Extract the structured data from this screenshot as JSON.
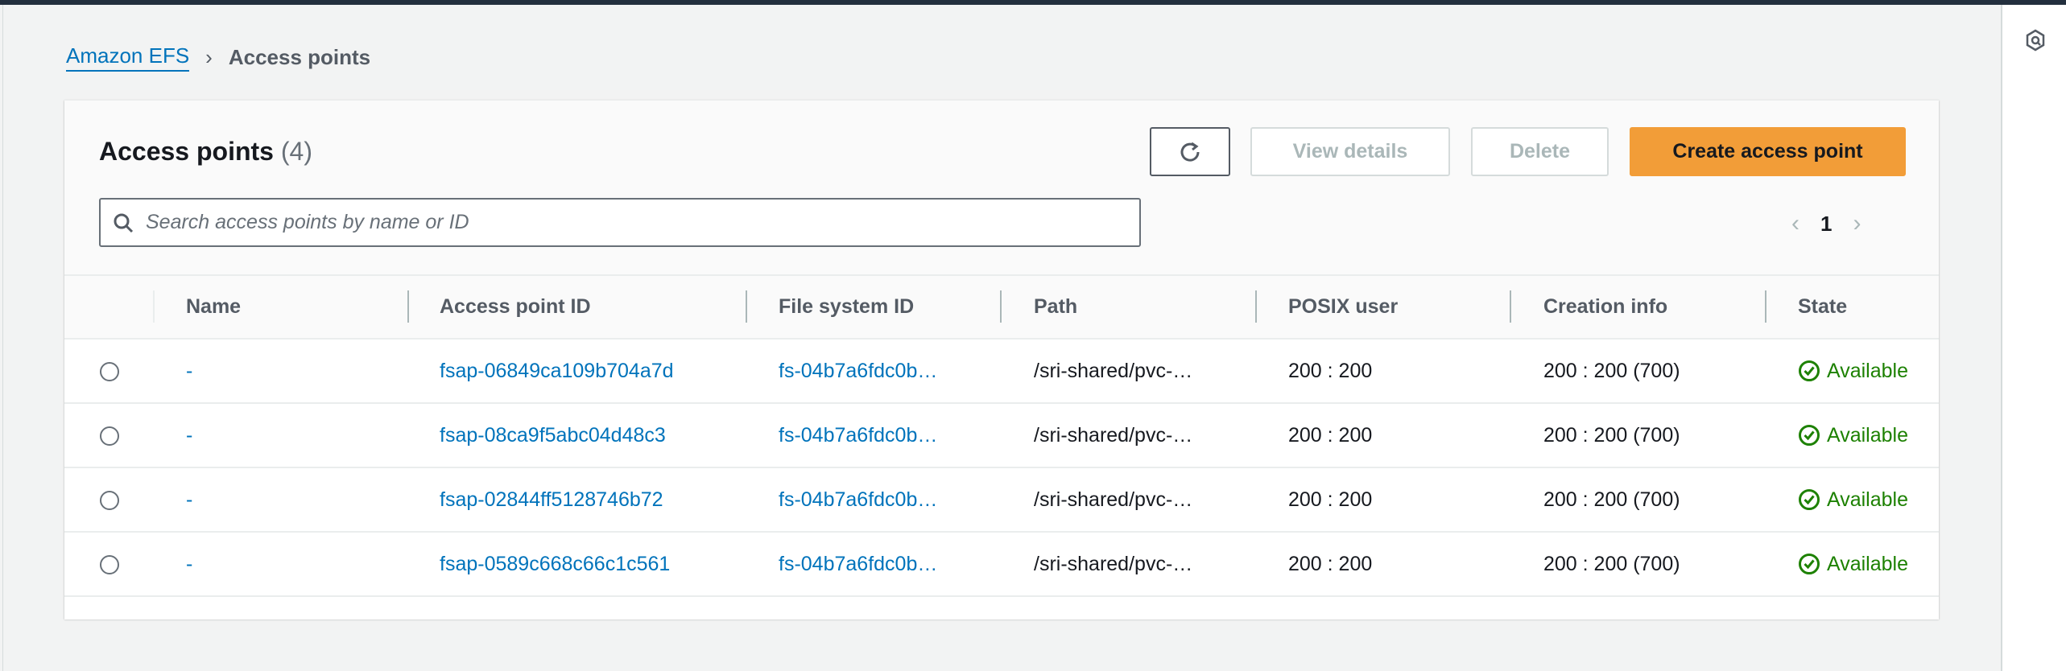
{
  "breadcrumb": {
    "parent": "Amazon EFS",
    "current": "Access points"
  },
  "header": {
    "title": "Access points",
    "count": "(4)"
  },
  "toolbar": {
    "refresh_icon": "refresh-icon",
    "view_details": "View details",
    "delete": "Delete",
    "create": "Create access point"
  },
  "search": {
    "placeholder": "Search access points by name or ID",
    "value": ""
  },
  "pagination": {
    "current": "1"
  },
  "columns": [
    "Name",
    "Access point ID",
    "File system ID",
    "Path",
    "POSIX user",
    "Creation info",
    "State"
  ],
  "rows": [
    {
      "name": "-",
      "ap_id": "fsap-06849ca109b704a7d",
      "fs_id": "fs-04b7a6fdc0b…",
      "path": "/sri-shared/pvc-…",
      "posix": "200 : 200",
      "creation": "200 : 200 (700)",
      "state": "Available"
    },
    {
      "name": "-",
      "ap_id": "fsap-08ca9f5abc04d48c3",
      "fs_id": "fs-04b7a6fdc0b…",
      "path": "/sri-shared/pvc-…",
      "posix": "200 : 200",
      "creation": "200 : 200 (700)",
      "state": "Available"
    },
    {
      "name": "-",
      "ap_id": "fsap-02844ff5128746b72",
      "fs_id": "fs-04b7a6fdc0b…",
      "path": "/sri-shared/pvc-…",
      "posix": "200 : 200",
      "creation": "200 : 200 (700)",
      "state": "Available"
    },
    {
      "name": "-",
      "ap_id": "fsap-0589c668c66c1c561",
      "fs_id": "fs-04b7a6fdc0b…",
      "path": "/sri-shared/pvc-…",
      "posix": "200 : 200",
      "creation": "200 : 200 (700)",
      "state": "Available"
    }
  ],
  "colors": {
    "accent": "#f29d38",
    "link": "#0073bb",
    "success": "#1d8102",
    "topbar": "#232f3e"
  }
}
